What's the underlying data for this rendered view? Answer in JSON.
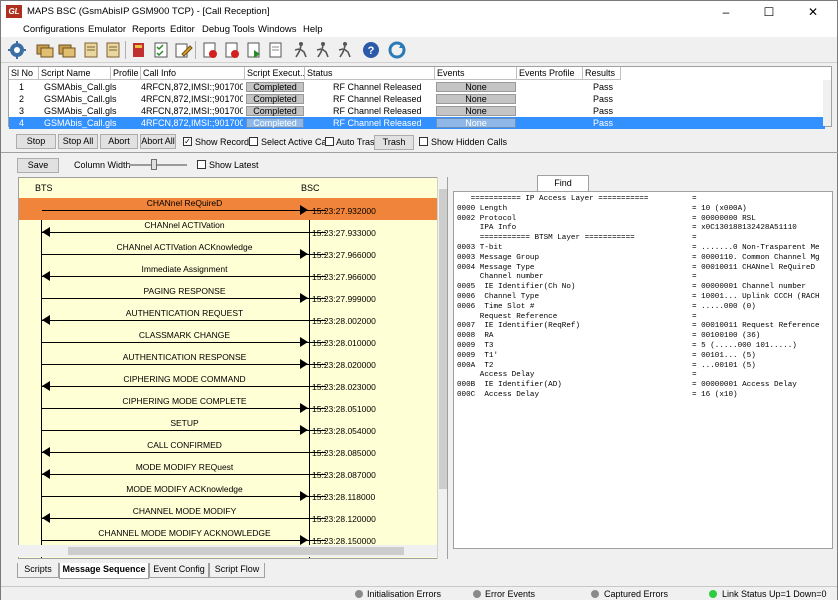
{
  "window": {
    "title": "MAPS BSC (GsmAbisIP GSM900 TCP) - [Call Reception]",
    "icon_text": "GL"
  },
  "menu": [
    "Configurations",
    "Emulator",
    "Reports",
    "Editor",
    "Debug Tools",
    "Windows",
    "Help"
  ],
  "toolbar_icons": [
    "gear-icon",
    "messages-icon",
    "messages-icon",
    "scroll-icon",
    "scroll-icon",
    "book-icon",
    "checklist-icon",
    "edit-icon",
    "doc-stop-icon",
    "doc-stop-icon",
    "doc-play-icon",
    "doc-icon",
    "run-icon",
    "run-icon",
    "run-icon",
    "help-icon",
    "refresh-icon"
  ],
  "grid": {
    "columns": [
      "Sl No",
      "Script Name",
      "Profile",
      "Call Info",
      "Script Execut...",
      "Status",
      "Events",
      "Events Profile",
      "Results"
    ],
    "rows": [
      {
        "sl": "1",
        "script": "GSMAbis_Call.gls",
        "profile": "",
        "info": "4RFCN,872,IMSI:;90170000...",
        "exec": "Completed",
        "status": "RF Channel Released",
        "events": "None",
        "ep": "",
        "result": "Pass"
      },
      {
        "sl": "2",
        "script": "GSMAbis_Call.gls",
        "profile": "",
        "info": "4RFCN,872,IMSI:;90170000...",
        "exec": "Completed",
        "status": "RF Channel Released",
        "events": "None",
        "ep": "",
        "result": "Pass"
      },
      {
        "sl": "3",
        "script": "GSMAbis_Call.gls",
        "profile": "",
        "info": "4RFCN,872,IMSI:;90170000...",
        "exec": "Completed",
        "status": "RF Channel Released",
        "events": "None",
        "ep": "",
        "result": "Pass"
      },
      {
        "sl": "4",
        "script": "GSMAbis_Call.gls",
        "profile": "",
        "info": "4RFCN,872,IMSI:;90170000...",
        "exec": "Completed",
        "status": "RF Channel Released",
        "events": "None",
        "ep": "",
        "result": "Pass"
      }
    ]
  },
  "controls": {
    "stop": "Stop",
    "stop_all": "Stop All",
    "abort": "Abort",
    "abort_all": "Abort All",
    "show_records": "Show Records",
    "select_active_call": "Select Active Call",
    "auto_trash": "Auto Trash",
    "trash": "Trash",
    "show_hidden_calls": "Show Hidden Calls",
    "save": "Save",
    "column_width": "Column Width",
    "show_latest": "Show Latest"
  },
  "msc": {
    "left_entity": "BTS",
    "right_entity": "BSC",
    "messages": [
      {
        "text": "CHANnel ReQuireD",
        "time": "15:23:27.932000",
        "dir": "right",
        "selected": true
      },
      {
        "text": "CHANnel ACTIVation",
        "time": "15:23:27.933000",
        "dir": "left"
      },
      {
        "text": "CHANnel ACTIVation ACKnowledge",
        "time": "15:23:27.966000",
        "dir": "right"
      },
      {
        "text": "Immediate Assignment",
        "time": "15:23:27.966000",
        "dir": "left"
      },
      {
        "text": "PAGING RESPONSE",
        "time": "15:23:27.999000",
        "dir": "right"
      },
      {
        "text": "AUTHENTICATION REQUEST",
        "time": "15:23:28.002000",
        "dir": "left"
      },
      {
        "text": "CLASSMARK CHANGE",
        "time": "15:23:28.010000",
        "dir": "right"
      },
      {
        "text": "AUTHENTICATION RESPONSE",
        "time": "15:23:28.020000",
        "dir": "right"
      },
      {
        "text": "CIPHERING MODE COMMAND",
        "time": "15:23:28.023000",
        "dir": "left"
      },
      {
        "text": "CIPHERING MODE COMPLETE",
        "time": "15:23:28.051000",
        "dir": "right"
      },
      {
        "text": "SETUP",
        "time": "15:23:28.054000",
        "dir": "right"
      },
      {
        "text": "CALL CONFIRMED",
        "time": "15:23:28.085000",
        "dir": "left"
      },
      {
        "text": "MODE MODIFY REQuest",
        "time": "15:23:28.087000",
        "dir": "left"
      },
      {
        "text": "MODE MODIFY ACKnowledge",
        "time": "15:23:28.118000",
        "dir": "right"
      },
      {
        "text": "CHANNEL MODE MODIFY",
        "time": "15:23:28.120000",
        "dir": "left"
      },
      {
        "text": "CHANNEL MODE MODIFY ACKNOWLEDGE",
        "time": "15:23:28.150000",
        "dir": "right"
      }
    ]
  },
  "detail": {
    "find": "Find",
    "lines": [
      {
        "l": "   =========== IP Access Layer ===========",
        "v": "="
      },
      {
        "l": "0000 Length",
        "v": "= 10 (x000A)"
      },
      {
        "l": "0002 Protocol",
        "v": "= 00000000 RSL"
      },
      {
        "l": "     IPA Info",
        "v": "= x0C130188132428A51110"
      },
      {
        "l": "     =========== BTSM Layer ===========",
        "v": "="
      },
      {
        "l": "0003 T-bit",
        "v": "= .......0 Non-Trasparent Me"
      },
      {
        "l": "0003 Message Group",
        "v": "= 0000110. Common Channel Mg"
      },
      {
        "l": "0004 Message Type",
        "v": "= 00010011 CHANnel ReQuireD"
      },
      {
        "l": "     Channel number",
        "v": "="
      },
      {
        "l": "0005  IE Identifier(Ch No)",
        "v": "= 00000001 Channel number"
      },
      {
        "l": "0006  Channel Type",
        "v": "= 10001... Uplink CCCH (RACH"
      },
      {
        "l": "0006  Time Slot #",
        "v": "= .....000 (0)"
      },
      {
        "l": "     Request Reference",
        "v": "="
      },
      {
        "l": "0007  IE Identifier(ReqRef)",
        "v": "= 00010011 Request Reference"
      },
      {
        "l": "0008  RA",
        "v": "= 00100100 (36)"
      },
      {
        "l": "0009  T3",
        "v": "= 5 (.....000 101.....)"
      },
      {
        "l": "0009  T1'",
        "v": "= 00101... (5)"
      },
      {
        "l": "000A  T2",
        "v": "= ...00101 (5)"
      },
      {
        "l": "     Access Delay",
        "v": "="
      },
      {
        "l": "000B  IE Identifier(AD)",
        "v": "= 00000001 Access Delay"
      },
      {
        "l": "000C  Access Delay",
        "v": "= 16 (x10)"
      }
    ]
  },
  "tabs": [
    "Scripts",
    "Message Sequence",
    "Event Config",
    "Script Flow"
  ],
  "active_tab": "Message Sequence",
  "status": {
    "init_errors": "Initialisation Errors",
    "error_events": "Error Events",
    "captured_errors": "Captured Errors",
    "link_status": "Link Status Up=1 Down=0",
    "colors": {
      "gray": "#8a8a8a",
      "green": "#2ecc40"
    }
  }
}
